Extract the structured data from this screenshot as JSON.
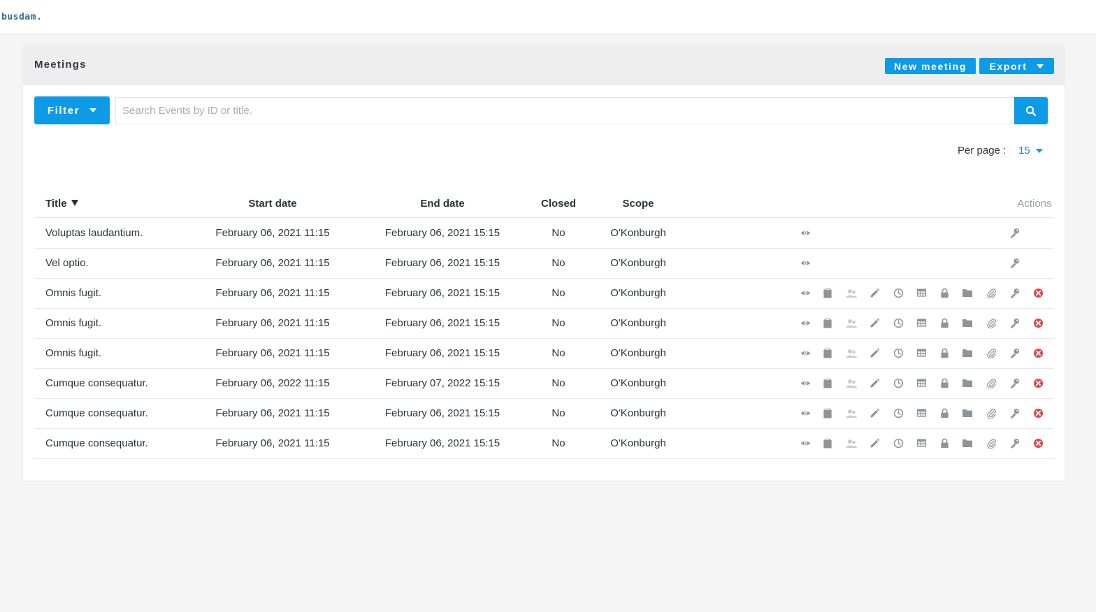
{
  "brand": "busdam.",
  "header": {
    "title": "Meetings",
    "new_label": "New meeting",
    "export_label": "Export"
  },
  "filter": {
    "label": "Filter"
  },
  "search": {
    "placeholder": "Search Events by ID or title."
  },
  "per_page": {
    "label": "Per page :",
    "value": "15"
  },
  "columns": {
    "title": "Title",
    "start": "Start date",
    "end": "End date",
    "closed": "Closed",
    "scope": "Scope",
    "actions": "Actions"
  },
  "colors": {
    "accent": "#0d9be8",
    "icon": "#8e949a",
    "icon_light": "#c9ccd0",
    "danger": "#e0494f"
  },
  "rows": [
    {
      "title": "Voluptas laudantium.",
      "start": "February 06, 2021 11:15",
      "end": "February 06, 2021 15:15",
      "closed": "No",
      "scope": "O'Konburgh",
      "actions": [
        "view",
        "key"
      ]
    },
    {
      "title": "Vel optio.",
      "start": "February 06, 2021 11:15",
      "end": "February 06, 2021 15:15",
      "closed": "No",
      "scope": "O'Konburgh",
      "actions": [
        "view",
        "key"
      ]
    },
    {
      "title": "Omnis fugit.",
      "start": "February 06, 2021 11:15",
      "end": "February 06, 2021 15:15",
      "closed": "No",
      "scope": "O'Konburgh",
      "actions": [
        "view",
        "clipboard",
        "users",
        "edit",
        "clock",
        "table",
        "lock",
        "folder",
        "attachment",
        "key",
        "delete"
      ]
    },
    {
      "title": "Omnis fugit.",
      "start": "February 06, 2021 11:15",
      "end": "February 06, 2021 15:15",
      "closed": "No",
      "scope": "O'Konburgh",
      "actions": [
        "view",
        "clipboard",
        "users",
        "edit",
        "clock",
        "table",
        "lock",
        "folder",
        "attachment",
        "key",
        "delete"
      ]
    },
    {
      "title": "Omnis fugit.",
      "start": "February 06, 2021 11:15",
      "end": "February 06, 2021 15:15",
      "closed": "No",
      "scope": "O'Konburgh",
      "actions": [
        "view",
        "clipboard",
        "users",
        "edit",
        "clock",
        "table",
        "lock",
        "folder",
        "attachment",
        "key",
        "delete"
      ]
    },
    {
      "title": "Cumque consequatur.",
      "start": "February 06, 2022 11:15",
      "end": "February 07, 2022 15:15",
      "closed": "No",
      "scope": "O'Konburgh",
      "actions": [
        "view",
        "clipboard",
        "users",
        "edit",
        "clock",
        "table",
        "lock",
        "folder",
        "attachment",
        "key",
        "delete"
      ]
    },
    {
      "title": "Cumque consequatur.",
      "start": "February 06, 2021 11:15",
      "end": "February 06, 2021 15:15",
      "closed": "No",
      "scope": "O'Konburgh",
      "actions": [
        "view",
        "clipboard",
        "users",
        "edit",
        "clock",
        "table",
        "lock",
        "folder",
        "attachment",
        "key",
        "delete"
      ]
    },
    {
      "title": "Cumque consequatur.",
      "start": "February 06, 2021 11:15",
      "end": "February 06, 2021 15:15",
      "closed": "No",
      "scope": "O'Konburgh",
      "actions": [
        "view",
        "clipboard",
        "users",
        "edit",
        "clock",
        "table",
        "lock",
        "folder",
        "attachment",
        "key",
        "delete"
      ]
    }
  ]
}
